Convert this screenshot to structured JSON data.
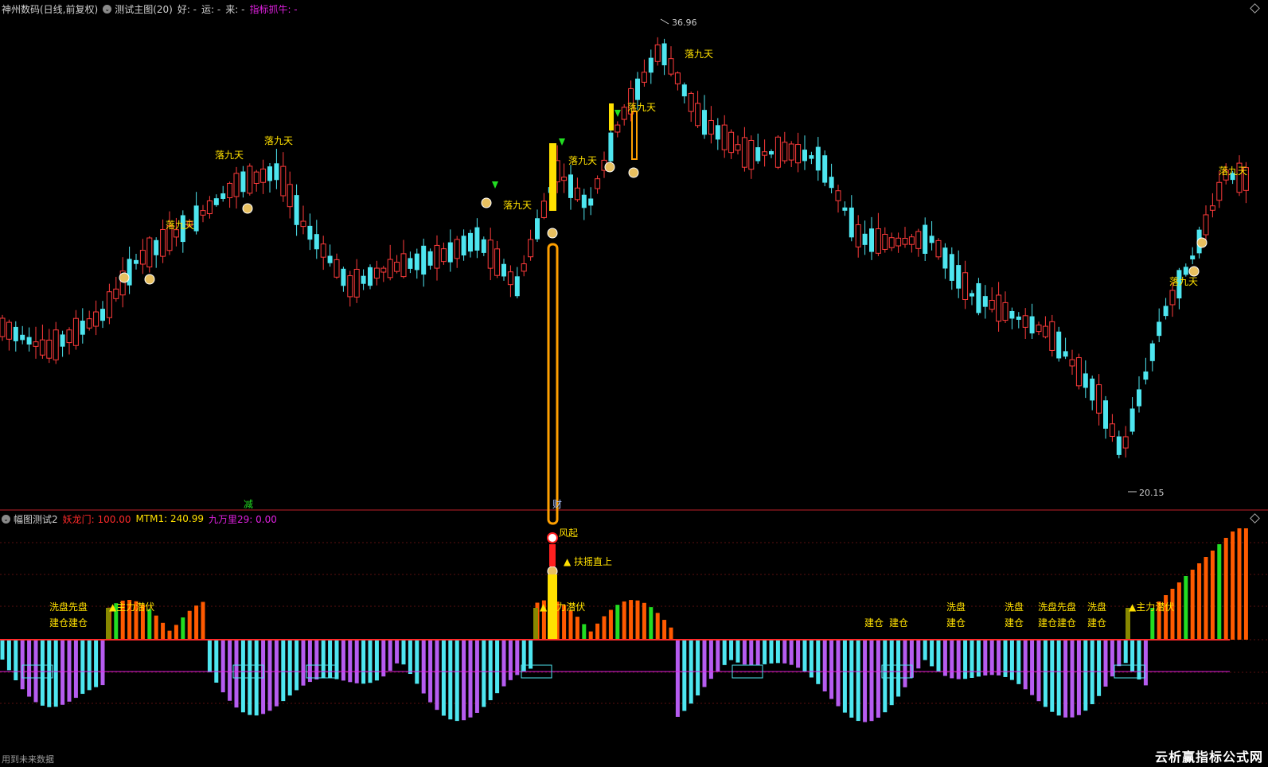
{
  "header": {
    "title": "神州数码(日线,前复权)",
    "indicator_name": "测试主图(20)",
    "good_label": "好: -",
    "luck_label": "运: -",
    "come_label": "来: -",
    "pick_label": "指标抓牛: -"
  },
  "subheader": {
    "indicator_name": "幅图测试2",
    "yaolongmen": "妖龙门: 100.00",
    "mtm1": "MTM1: 240.99",
    "jiuwanli": "九万里29: 0.00"
  },
  "price_marks": {
    "high": "36.96",
    "low": "20.15"
  },
  "main_labels": {
    "luojiutian": "落九天",
    "jian": "减",
    "fa_cai": "财"
  },
  "sub_labels": {
    "feng_qi": "风起",
    "fuyao": "扶摇直上",
    "zhuli": "主力潜伏",
    "xipan": "洗盘",
    "jiancang": "建仓",
    "xipan_xianpan": "洗盘先盘",
    "jiancang_jiancang": "建仓建仓"
  },
  "footer": {
    "left_text": "用到未来数据",
    "watermark": "云析赢指标公式网"
  },
  "colors": {
    "up": "#ff3b3b",
    "down": "#4ee6f0",
    "yellow": "#ffe000",
    "orange": "#ff5a00",
    "green": "#22dd22",
    "purple": "#b65cf0",
    "magenta": "#e020e0",
    "separator": "#c0202a"
  }
}
